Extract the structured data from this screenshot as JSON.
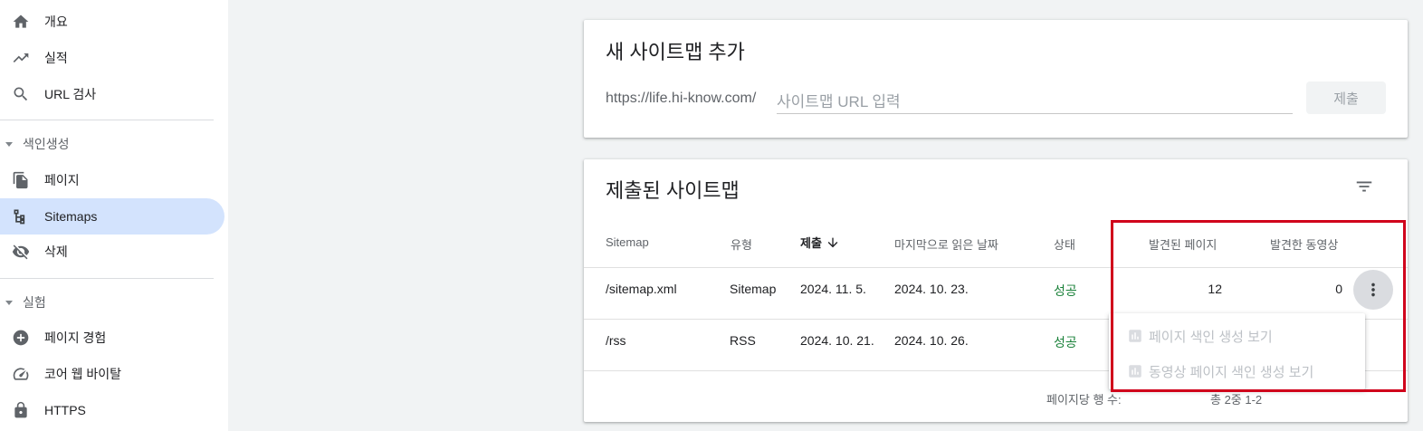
{
  "sidebar": {
    "top_items": [
      {
        "label": "개요",
        "icon": "home-icon"
      },
      {
        "label": "실적",
        "icon": "trending-up-icon"
      },
      {
        "label": "URL 검사",
        "icon": "search-icon"
      }
    ],
    "section_indexing": {
      "label": "색인생성",
      "items": [
        {
          "label": "페이지",
          "icon": "copy-pages-icon"
        },
        {
          "label": "Sitemaps",
          "icon": "sitemap-icon"
        },
        {
          "label": "삭제",
          "icon": "eye-off-icon"
        }
      ]
    },
    "section_experience": {
      "label": "실험",
      "items": [
        {
          "label": "페이지 경험",
          "icon": "add-circle-icon"
        },
        {
          "label": "코어 웹 바이탈",
          "icon": "speedometer-icon"
        },
        {
          "label": "HTTPS",
          "icon": "lock-icon"
        }
      ]
    },
    "active_item": "Sitemaps"
  },
  "add_sitemap": {
    "title": "새 사이트맵 추가",
    "url_prefix": "https://life.hi-know.com/",
    "input_placeholder": "사이트맵 URL 입력",
    "input_value": "",
    "submit_label": "제출"
  },
  "submitted": {
    "title": "제출된 사이트맵",
    "columns": [
      "Sitemap",
      "유형",
      "제출",
      "마지막으로 읽은 날짜",
      "상태",
      "발견된 페이지",
      "발견한 동영상"
    ],
    "sort_column": "제출",
    "rows": [
      {
        "sitemap": "/sitemap.xml",
        "type": "Sitemap",
        "submitted": "2024. 11. 5.",
        "last_read": "2024. 10. 23.",
        "status": "성공",
        "pages": "12",
        "videos": "0"
      },
      {
        "sitemap": "/rss",
        "type": "RSS",
        "submitted": "2024. 10. 21.",
        "last_read": "2024. 10. 26.",
        "status": "성공",
        "pages": "",
        "videos": ""
      }
    ],
    "pager_label": "페이지당 행 수:",
    "pager_rest": "총 2중 1-2"
  },
  "menu": {
    "items": [
      {
        "label": "페이지 색인 생성 보기",
        "icon": "bar-chart-icon"
      },
      {
        "label": "동영상 페이지 색인 생성 보기",
        "icon": "bar-chart-icon"
      }
    ]
  },
  "colors": {
    "active_nav": "#d3e3fd",
    "success": "#188038",
    "highlight": "#d0021b"
  }
}
